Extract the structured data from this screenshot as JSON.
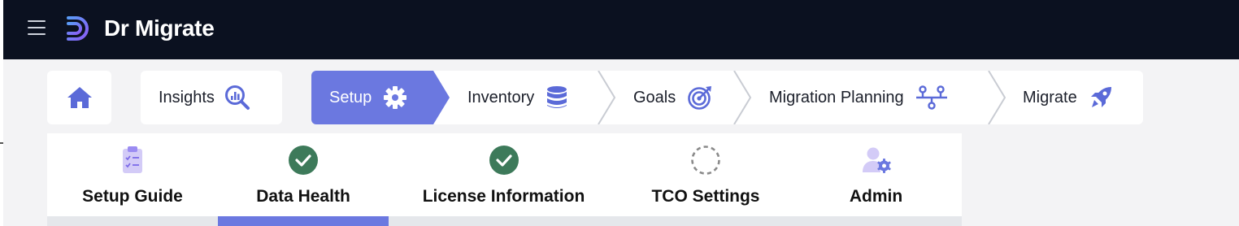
{
  "app": {
    "name": "Dr Migrate"
  },
  "nav": {
    "home_icon": "home-icon",
    "insights": {
      "label": "Insights",
      "icon": "magnifier-chart-icon"
    }
  },
  "steps": [
    {
      "label": "Setup",
      "icon": "gear-icon",
      "active": true
    },
    {
      "label": "Inventory",
      "icon": "database-icon",
      "active": false
    },
    {
      "label": "Goals",
      "icon": "target-icon",
      "active": false
    },
    {
      "label": "Migration Planning",
      "icon": "network-icon",
      "active": false
    },
    {
      "label": "Migrate",
      "icon": "rocket-icon",
      "active": false
    }
  ],
  "tabs": [
    {
      "label": "Setup Guide",
      "icon": "clipboard-checklist-icon",
      "status": ""
    },
    {
      "label": "Data Health",
      "icon": "check-circle-icon",
      "status": "complete",
      "selected": true
    },
    {
      "label": "License Information",
      "icon": "check-circle-icon",
      "status": "complete"
    },
    {
      "label": "TCO Settings",
      "icon": "dashed-circle-icon",
      "status": "pending"
    },
    {
      "label": "Admin",
      "icon": "user-gear-icon",
      "status": ""
    }
  ],
  "colors": {
    "accent": "#6b78e0",
    "topbar": "#0b1120",
    "success": "#3d7a5a",
    "icon": "#5b6ad8"
  }
}
